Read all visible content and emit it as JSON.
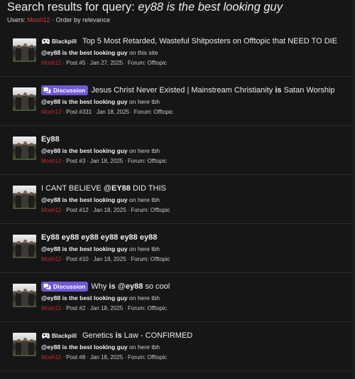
{
  "page": {
    "title_prefix": "Search results for query: ",
    "title_query": "ey88 is the best looking guy",
    "users_label": "Users:",
    "users_value": "Mosh12",
    "order_text": "Order by relevance"
  },
  "colors": {
    "discussion_label": "#6f57d6",
    "author_link": "#b83232",
    "background": "#161616"
  },
  "results": [
    {
      "label": "Blackpill",
      "label_type": "blackpill",
      "label_icon": "gamepad-icon",
      "title_parts": [
        {
          "text": "Top 5 Most Retarded, Wasteful Shitposters on Offtopic that NEED TO DIE",
          "bold": false
        }
      ],
      "snippet_bold": "@ey88 is the best looking guy",
      "snippet_rest": " on this site",
      "author": "Mosh12",
      "post": "Post #5",
      "date": "Jan 27, 2025",
      "forum": "Forum: Offtopic"
    },
    {
      "label": "Discussion",
      "label_type": "discussion",
      "label_icon": "chat-bubbles-icon",
      "title_parts": [
        {
          "text": "Jesus Christ Never Existed | Mainstream Christianity ",
          "bold": false
        },
        {
          "text": "is",
          "bold": true
        },
        {
          "text": " Satan Worship",
          "bold": false
        }
      ],
      "snippet_bold": "@ey88 is the best looking guy",
      "snippet_rest": " on here tbh",
      "author": "Mosh12",
      "post": "Post #331",
      "date": "Jan 18, 2025",
      "forum": "Forum: Offtopic"
    },
    {
      "label": "",
      "label_type": "none",
      "label_icon": "",
      "title_parts": [
        {
          "text": "Ey88",
          "bold": true
        }
      ],
      "snippet_bold": "@ey88 is the best looking guy",
      "snippet_rest": " on here tbh",
      "author": "Mosh12",
      "post": "Post #3",
      "date": "Jan 18, 2025",
      "forum": "Forum: Offtopic"
    },
    {
      "label": "",
      "label_type": "none",
      "label_icon": "",
      "title_parts": [
        {
          "text": "I CANT BELIEVE @",
          "bold": false
        },
        {
          "text": "EY88",
          "bold": true
        },
        {
          "text": " DID THIS",
          "bold": false
        }
      ],
      "snippet_bold": "@ey88 is the best looking guy",
      "snippet_rest": " on here tbh",
      "author": "Mosh12",
      "post": "Post #12",
      "date": "Jan 18, 2025",
      "forum": "Forum: Offtopic"
    },
    {
      "label": "",
      "label_type": "none",
      "label_icon": "",
      "title_parts": [
        {
          "text": "Ey88 ey88 ey88 ey88 ey88 ey88",
          "bold": true
        }
      ],
      "snippet_bold": "@ey88 is the best looking guy",
      "snippet_rest": " on here tbh",
      "author": "Mosh12",
      "post": "Post #10",
      "date": "Jan 18, 2025",
      "forum": "Forum: Offtopic"
    },
    {
      "label": "Discussion",
      "label_type": "discussion",
      "label_icon": "chat-bubbles-icon",
      "title_parts": [
        {
          "text": "Why ",
          "bold": false
        },
        {
          "text": "is",
          "bold": true
        },
        {
          "text": " @",
          "bold": false
        },
        {
          "text": "ey88",
          "bold": true
        },
        {
          "text": " so cool",
          "bold": false
        }
      ],
      "snippet_bold": "@ey88 is the best looking guy",
      "snippet_rest": " on here tbh",
      "author": "Mosh12",
      "post": "Post #2",
      "date": "Jan 18, 2025",
      "forum": "Forum: Offtopic"
    },
    {
      "label": "Blackpill",
      "label_type": "blackpill",
      "label_icon": "gamepad-icon",
      "title_parts": [
        {
          "text": "Genetics ",
          "bold": false
        },
        {
          "text": "is",
          "bold": true
        },
        {
          "text": " Law - CONFIRMED",
          "bold": false
        }
      ],
      "snippet_bold": "@ey88 is the best looking guy",
      "snippet_rest": " on here tbh",
      "author": "Mosh12",
      "post": "Post #8",
      "date": "Jan 18, 2025",
      "forum": "Forum: Offtopic"
    }
  ]
}
